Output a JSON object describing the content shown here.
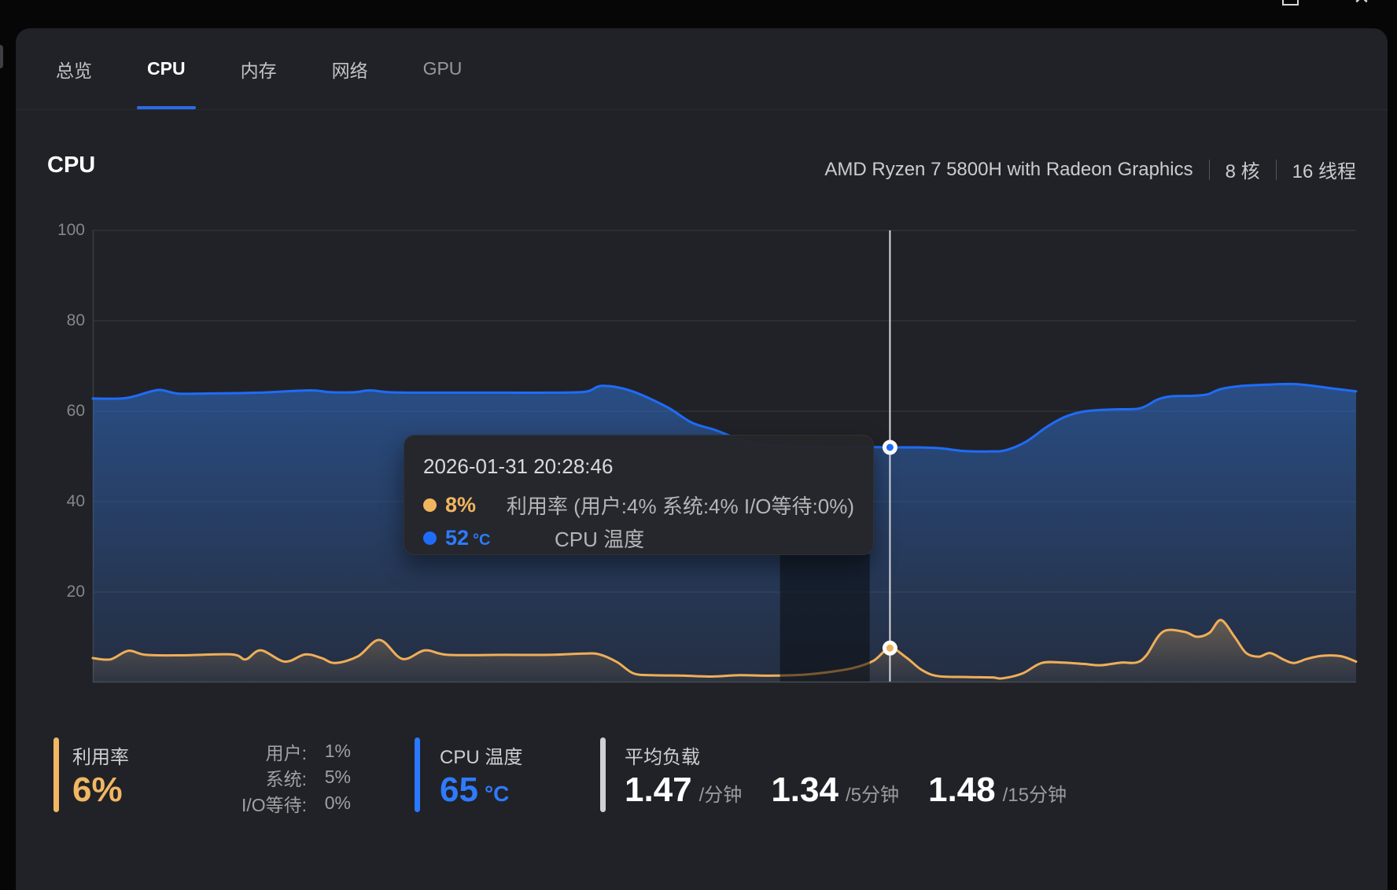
{
  "window": {
    "maximize_label": "maximize",
    "close_glyph": "✕"
  },
  "tabs": [
    {
      "label": "总览",
      "active": false
    },
    {
      "label": "CPU",
      "active": true
    },
    {
      "label": "内存",
      "active": false
    },
    {
      "label": "网络",
      "active": false
    },
    {
      "label": "GPU",
      "active": false
    }
  ],
  "header": {
    "title": "CPU",
    "cpu_model": "AMD Ryzen 7 5800H with Radeon Graphics",
    "cores": "8 核",
    "threads": "16 线程"
  },
  "chart_data": {
    "type": "area",
    "ylim": [
      0,
      100
    ],
    "yticks": [
      20,
      40,
      60,
      80,
      100
    ],
    "grid": true,
    "colors": {
      "grid": "#313237",
      "axis_left": "#3d3e42",
      "axis_bottom": "#4a4b4f",
      "crosshair": "#d9dadc"
    },
    "series": [
      {
        "name": "CPU 温度",
        "unit": "°C",
        "color": "#1f6cf9",
        "fill_top": "rgba(47,107,196,0.60)",
        "fill_bottom": "rgba(47,90,160,0.22)",
        "points": [
          [
            0,
            62.8
          ],
          [
            0.026,
            62.9
          ],
          [
            0.045,
            64.3
          ],
          [
            0.054,
            64.7
          ],
          [
            0.067,
            63.9
          ],
          [
            0.088,
            63.9
          ],
          [
            0.132,
            64.1
          ],
          [
            0.172,
            64.6
          ],
          [
            0.188,
            64.2
          ],
          [
            0.207,
            64.2
          ],
          [
            0.219,
            64.6
          ],
          [
            0.235,
            64.2
          ],
          [
            0.257,
            64.1
          ],
          [
            0.288,
            64.1
          ],
          [
            0.325,
            64.1
          ],
          [
            0.362,
            64.1
          ],
          [
            0.39,
            64.3
          ],
          [
            0.403,
            65.6
          ],
          [
            0.425,
            64.6
          ],
          [
            0.454,
            61
          ],
          [
            0.474,
            57.5
          ],
          [
            0.493,
            55.8
          ],
          [
            0.518,
            53.2
          ],
          [
            0.54,
            52.4
          ],
          [
            0.562,
            52.1
          ],
          [
            0.587,
            52
          ],
          [
            0.611,
            52.1
          ],
          [
            0.631,
            52
          ],
          [
            0.652,
            52
          ],
          [
            0.671,
            51.8
          ],
          [
            0.689,
            51.2
          ],
          [
            0.711,
            51.1
          ],
          [
            0.723,
            51.4
          ],
          [
            0.739,
            53.3
          ],
          [
            0.755,
            56.5
          ],
          [
            0.77,
            58.8
          ],
          [
            0.786,
            60
          ],
          [
            0.808,
            60.4
          ],
          [
            0.826,
            60.5
          ],
          [
            0.834,
            61.2
          ],
          [
            0.843,
            62.6
          ],
          [
            0.854,
            63.3
          ],
          [
            0.87,
            63.4
          ],
          [
            0.882,
            63.7
          ],
          [
            0.893,
            64.9
          ],
          [
            0.91,
            65.6
          ],
          [
            0.932,
            65.9
          ],
          [
            0.951,
            66
          ],
          [
            0.966,
            65.6
          ],
          [
            0.982,
            65
          ],
          [
            1,
            64.4
          ]
        ]
      },
      {
        "name": "利用率",
        "unit": "%",
        "color": "#f0ae58",
        "fill_top": "rgba(235,175,90,0.32)",
        "fill_bottom": "rgba(235,175,90,0.04)",
        "points": [
          [
            0,
            5.4
          ],
          [
            0.014,
            5.1
          ],
          [
            0.028,
            7
          ],
          [
            0.042,
            6.1
          ],
          [
            0.07,
            6
          ],
          [
            0.11,
            6.2
          ],
          [
            0.121,
            5.1
          ],
          [
            0.133,
            7.1
          ],
          [
            0.152,
            4.6
          ],
          [
            0.168,
            6.2
          ],
          [
            0.181,
            5.4
          ],
          [
            0.192,
            4.3
          ],
          [
            0.21,
            5.8
          ],
          [
            0.227,
            9.4
          ],
          [
            0.245,
            5.2
          ],
          [
            0.263,
            7.1
          ],
          [
            0.281,
            6.1
          ],
          [
            0.325,
            6.1
          ],
          [
            0.362,
            6.1
          ],
          [
            0.389,
            6.4
          ],
          [
            0.401,
            6.2
          ],
          [
            0.415,
            4.5
          ],
          [
            0.428,
            2
          ],
          [
            0.443,
            1.6
          ],
          [
            0.468,
            1.5
          ],
          [
            0.49,
            1.3
          ],
          [
            0.512,
            1.6
          ],
          [
            0.537,
            1.5
          ],
          [
            0.562,
            1.7
          ],
          [
            0.583,
            2.3
          ],
          [
            0.602,
            3.2
          ],
          [
            0.618,
            4.8
          ],
          [
            0.631,
            7.6
          ],
          [
            0.644,
            5.5
          ],
          [
            0.656,
            2.8
          ],
          [
            0.669,
            1.4
          ],
          [
            0.692,
            1.2
          ],
          [
            0.712,
            1.1
          ],
          [
            0.72,
            0.9
          ],
          [
            0.736,
            2
          ],
          [
            0.751,
            4.3
          ],
          [
            0.768,
            4.4
          ],
          [
            0.784,
            4.1
          ],
          [
            0.798,
            3.8
          ],
          [
            0.814,
            4.4
          ],
          [
            0.826,
            4.4
          ],
          [
            0.834,
            6
          ],
          [
            0.847,
            11.2
          ],
          [
            0.864,
            11.2
          ],
          [
            0.874,
            10.1
          ],
          [
            0.884,
            11
          ],
          [
            0.893,
            13.8
          ],
          [
            0.904,
            10
          ],
          [
            0.913,
            6.5
          ],
          [
            0.923,
            5.7
          ],
          [
            0.932,
            6.5
          ],
          [
            0.943,
            5
          ],
          [
            0.951,
            4.3
          ],
          [
            0.961,
            5.2
          ],
          [
            0.973,
            5.9
          ],
          [
            0.988,
            5.8
          ],
          [
            1,
            4.6
          ]
        ]
      }
    ],
    "pointer": {
      "x": 0.631,
      "band": {
        "x1": 0.544,
        "x2": 0.615,
        "y": 0.716,
        "color": "rgba(8,9,11,0.52)"
      },
      "dots": [
        {
          "value": 52,
          "color": "#1f6cf9"
        },
        {
          "value": 7.6,
          "color": "#f0ae58"
        }
      ]
    }
  },
  "tooltip": {
    "timestamp": "2026-01-31 20:28:46",
    "rows": [
      {
        "value": "8%",
        "unit": "",
        "label": "利用率 (用户:4% 系统:4% I/O等待:0%)",
        "color": "#f2b55f"
      },
      {
        "value": "52",
        "unit": "°C",
        "label": "CPU 温度",
        "color": "#1f6cf9"
      }
    ]
  },
  "footer": {
    "utilization": {
      "label": "利用率",
      "value": "6%",
      "color": "#f1b763"
    },
    "substats": [
      {
        "label": "用户:",
        "value": "1%"
      },
      {
        "label": "系统:",
        "value": "5%"
      },
      {
        "label": "I/O等待:",
        "value": "0%"
      }
    ],
    "temperature": {
      "label": "CPU 温度",
      "value": "65",
      "unit": "°C",
      "color": "#2e7bff"
    },
    "load": {
      "label": "平均负载",
      "bar_color": "#ced0d4",
      "items": [
        {
          "value": "1.47",
          "unit": "/分钟"
        },
        {
          "value": "1.34",
          "unit": "/5分钟"
        },
        {
          "value": "1.48",
          "unit": "/15分钟"
        }
      ]
    }
  }
}
